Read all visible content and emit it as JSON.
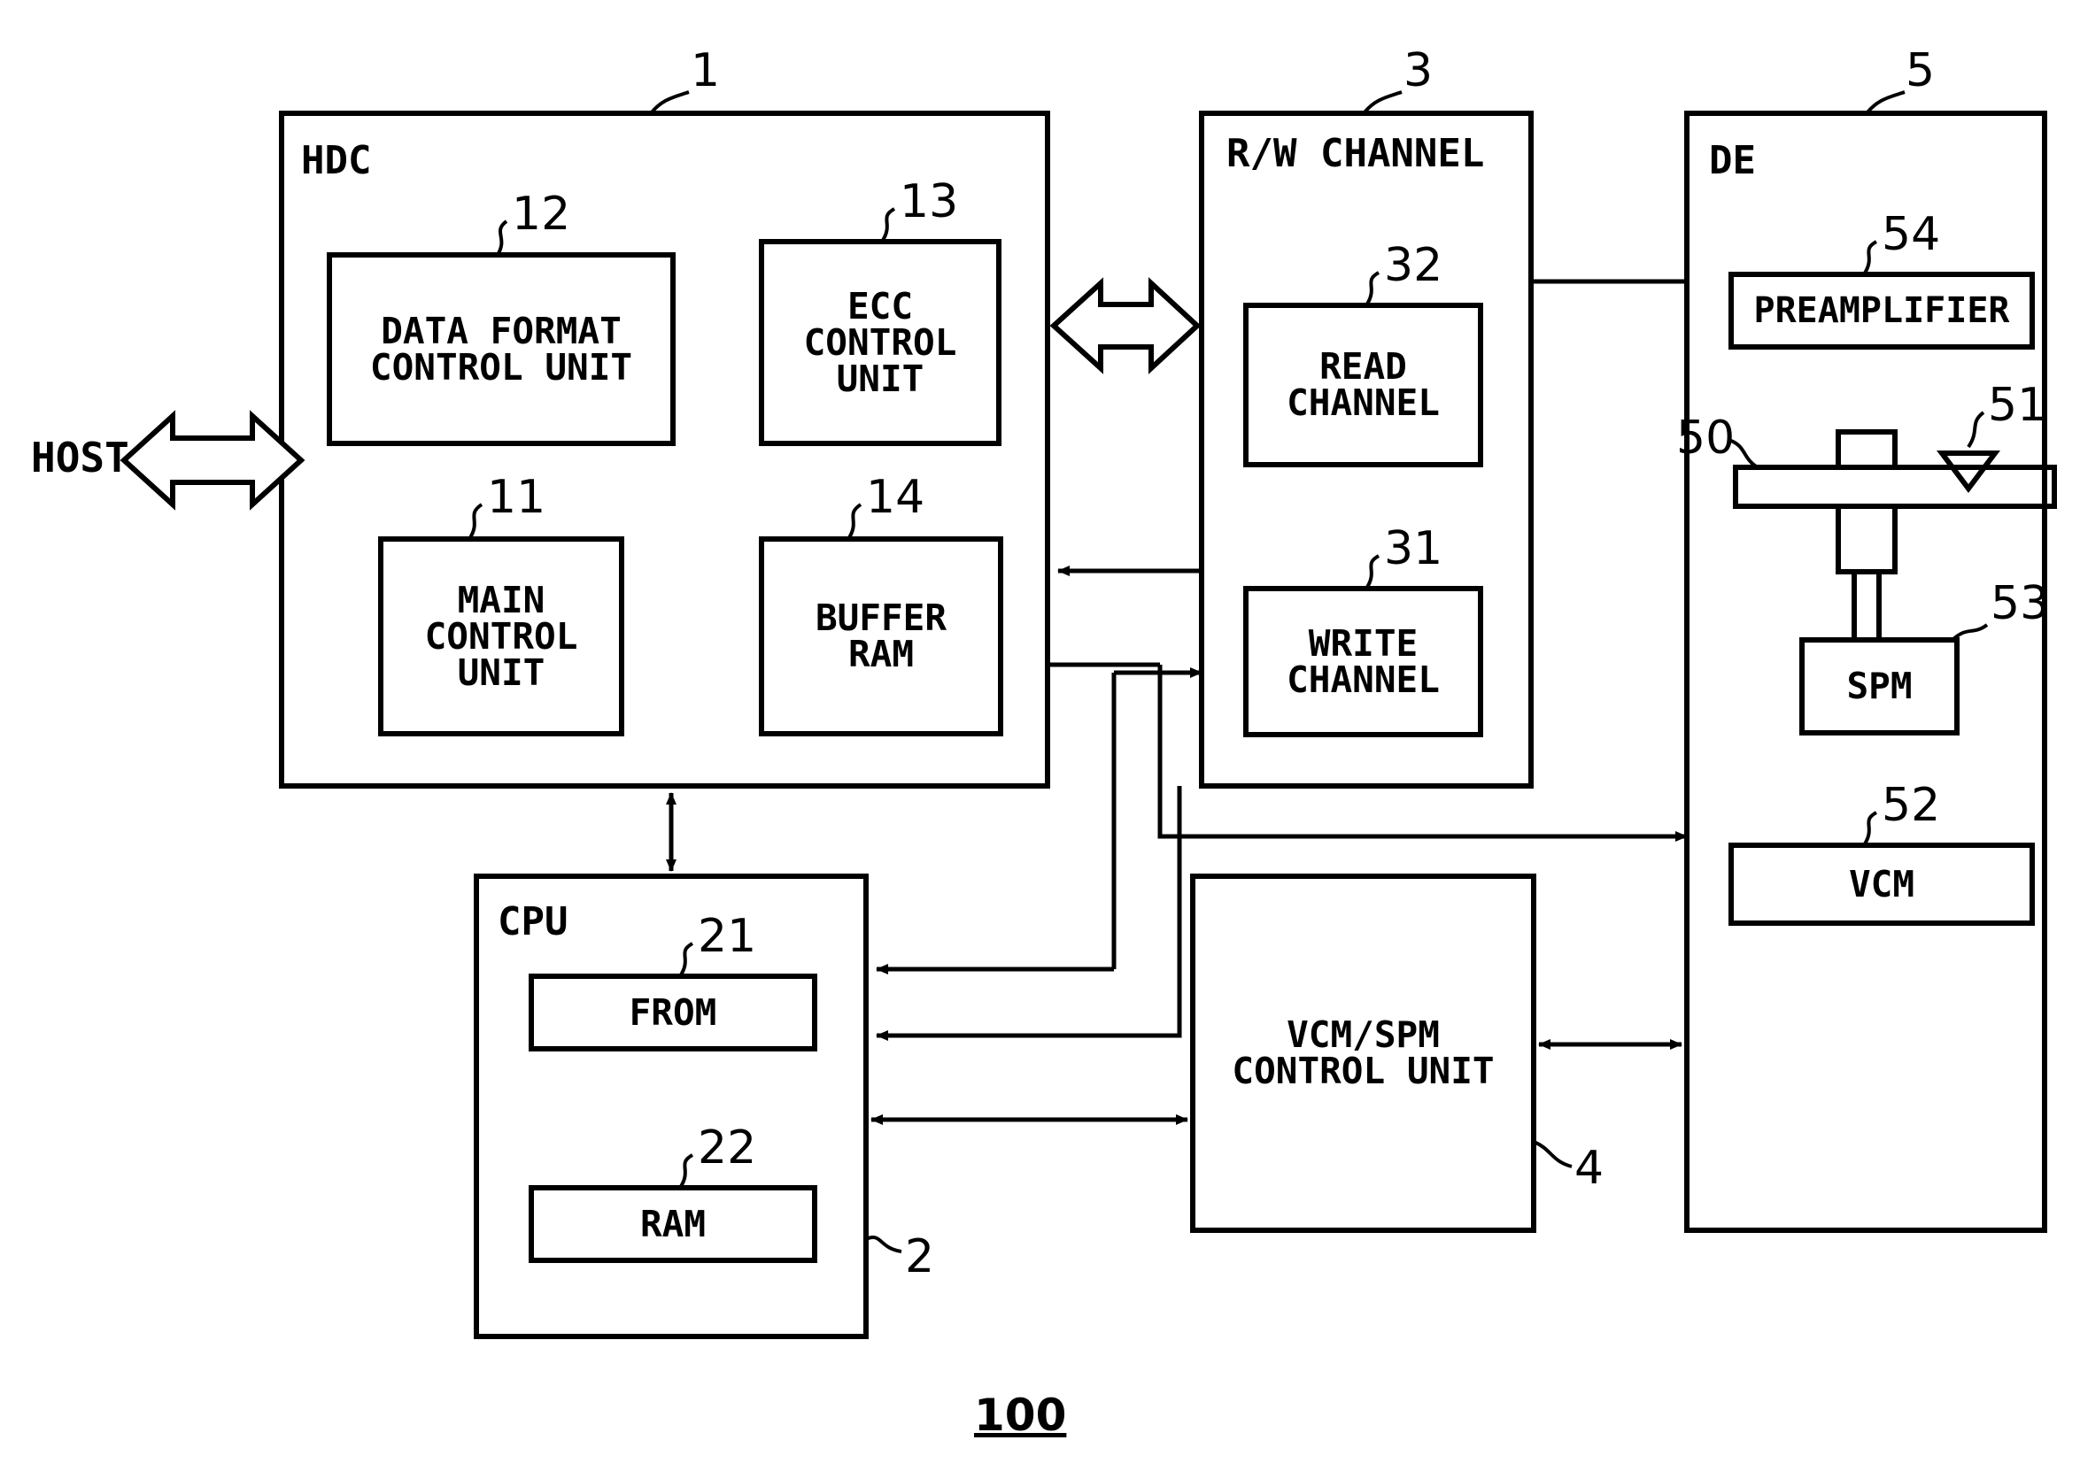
{
  "figure": {
    "number": "100",
    "external_label": "HOST"
  },
  "blocks": {
    "hdc": {
      "title": "HDC",
      "ref": "1",
      "children": [
        {
          "id": "data_format_control_unit",
          "lines": [
            "DATA FORMAT",
            "CONTROL UNIT"
          ],
          "ref": "12"
        },
        {
          "id": "ecc_control_unit",
          "lines": [
            "ECC",
            "CONTROL",
            "UNIT"
          ],
          "ref": "13"
        },
        {
          "id": "main_control_unit",
          "lines": [
            "MAIN",
            "CONTROL",
            "UNIT"
          ],
          "ref": "11"
        },
        {
          "id": "buffer_ram",
          "lines": [
            "BUFFER",
            "RAM"
          ],
          "ref": "14"
        }
      ]
    },
    "rw_channel": {
      "title": "R/W CHANNEL",
      "ref": "3",
      "children": [
        {
          "id": "read_channel",
          "lines": [
            "READ",
            "CHANNEL"
          ],
          "ref": "32"
        },
        {
          "id": "write_channel",
          "lines": [
            "WRITE",
            "CHANNEL"
          ],
          "ref": "31"
        }
      ]
    },
    "de": {
      "title": "DE",
      "ref": "5",
      "children": [
        {
          "id": "preamplifier",
          "lines": [
            "PREAMPLIFIER"
          ],
          "ref": "54"
        },
        {
          "id": "disk",
          "lines": [],
          "ref": "50"
        },
        {
          "id": "head",
          "lines": [],
          "ref": "51"
        },
        {
          "id": "spm",
          "lines": [
            "SPM"
          ],
          "ref": "53"
        },
        {
          "id": "vcm",
          "lines": [
            "VCM"
          ],
          "ref": "52"
        }
      ]
    },
    "cpu": {
      "title": "CPU",
      "ref": "2",
      "children": [
        {
          "id": "from",
          "lines": [
            "FROM"
          ],
          "ref": "21"
        },
        {
          "id": "ram",
          "lines": [
            "RAM"
          ],
          "ref": "22"
        }
      ]
    },
    "vcm_spm_control": {
      "title": "",
      "lines": [
        "VCM/SPM",
        "CONTROL UNIT"
      ],
      "ref": "4"
    }
  },
  "colors": {
    "line": "#000000",
    "background": "#ffffff"
  }
}
